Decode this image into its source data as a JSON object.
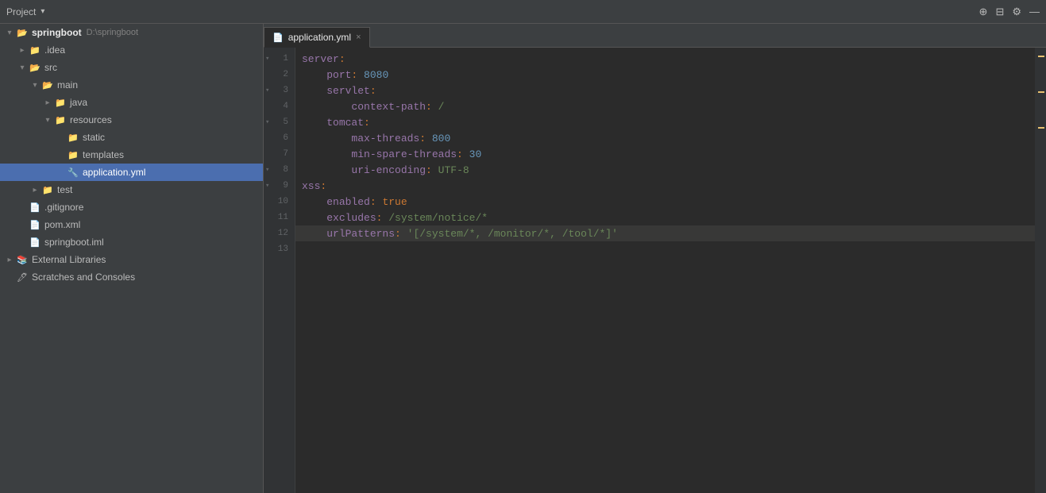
{
  "titleBar": {
    "projectLabel": "Project",
    "icons": {
      "add": "+",
      "layout": "⊟",
      "gear": "⚙",
      "minus": "—"
    }
  },
  "sidebar": {
    "items": [
      {
        "id": "springboot-root",
        "indent": 1,
        "label": "springboot",
        "path": "D:\\springboot",
        "arrow": "open",
        "icon": "folder-open",
        "bold": true
      },
      {
        "id": "idea",
        "indent": 2,
        "label": ".idea",
        "arrow": "closed",
        "icon": "folder"
      },
      {
        "id": "src",
        "indent": 2,
        "label": "src",
        "arrow": "open",
        "icon": "folder-open"
      },
      {
        "id": "main",
        "indent": 3,
        "label": "main",
        "arrow": "open",
        "icon": "folder-open"
      },
      {
        "id": "java",
        "indent": 4,
        "label": "java",
        "arrow": "closed",
        "icon": "folder-java"
      },
      {
        "id": "resources",
        "indent": 4,
        "label": "resources",
        "arrow": "open",
        "icon": "folder-resources"
      },
      {
        "id": "static",
        "indent": 5,
        "label": "static",
        "arrow": "empty",
        "icon": "folder"
      },
      {
        "id": "templates",
        "indent": 5,
        "label": "templates",
        "arrow": "empty",
        "icon": "folder"
      },
      {
        "id": "application-yml",
        "indent": 5,
        "label": "application.yml",
        "arrow": "empty",
        "icon": "yml",
        "selected": true
      },
      {
        "id": "test",
        "indent": 3,
        "label": "test",
        "arrow": "closed",
        "icon": "folder"
      },
      {
        "id": "gitignore",
        "indent": 2,
        "label": ".gitignore",
        "arrow": "empty",
        "icon": "gitignore"
      },
      {
        "id": "pom-xml",
        "indent": 2,
        "label": "pom.xml",
        "arrow": "empty",
        "icon": "xml"
      },
      {
        "id": "springboot-iml",
        "indent": 2,
        "label": "springboot.iml",
        "arrow": "empty",
        "icon": "iml"
      },
      {
        "id": "external-libraries",
        "indent": 1,
        "label": "External Libraries",
        "arrow": "closed",
        "icon": "libraries"
      },
      {
        "id": "scratches",
        "indent": 1,
        "label": "Scratches and Consoles",
        "arrow": "empty",
        "icon": "scratches"
      }
    ]
  },
  "tab": {
    "icon": "📄",
    "label": "application.yml",
    "closeIcon": "×"
  },
  "codeLines": [
    {
      "num": 1,
      "fold": true,
      "tokens": [
        {
          "type": "yaml-key",
          "text": "server"
        },
        {
          "type": "yaml-colon",
          "text": ":"
        }
      ]
    },
    {
      "num": 2,
      "fold": false,
      "tokens": [
        {
          "type": "yaml-text",
          "text": "  "
        },
        {
          "type": "yaml-key",
          "text": "  port"
        },
        {
          "type": "yaml-colon",
          "text": ":"
        },
        {
          "type": "yaml-text",
          "text": " "
        },
        {
          "type": "yaml-value-num",
          "text": "8080"
        }
      ]
    },
    {
      "num": 3,
      "fold": true,
      "tokens": [
        {
          "type": "yaml-text",
          "text": "  "
        },
        {
          "type": "yaml-key",
          "text": "  servlet"
        },
        {
          "type": "yaml-colon",
          "text": ":"
        }
      ]
    },
    {
      "num": 4,
      "fold": false,
      "tokens": [
        {
          "type": "yaml-text",
          "text": "    "
        },
        {
          "type": "yaml-key",
          "text": "    context-path"
        },
        {
          "type": "yaml-colon",
          "text": ":"
        },
        {
          "type": "yaml-text",
          "text": " "
        },
        {
          "type": "yaml-value-str",
          "text": "/"
        }
      ]
    },
    {
      "num": 5,
      "fold": true,
      "tokens": [
        {
          "type": "yaml-text",
          "text": "  "
        },
        {
          "type": "yaml-key",
          "text": "  tomcat"
        },
        {
          "type": "yaml-colon",
          "text": ":"
        }
      ]
    },
    {
      "num": 6,
      "fold": false,
      "tokens": [
        {
          "type": "yaml-text",
          "text": "    "
        },
        {
          "type": "yaml-key",
          "text": "    max-threads"
        },
        {
          "type": "yaml-colon",
          "text": ":"
        },
        {
          "type": "yaml-text",
          "text": " "
        },
        {
          "type": "yaml-value-num",
          "text": "800"
        }
      ]
    },
    {
      "num": 7,
      "fold": false,
      "tokens": [
        {
          "type": "yaml-text",
          "text": "    "
        },
        {
          "type": "yaml-key",
          "text": "    min-spare-threads"
        },
        {
          "type": "yaml-colon",
          "text": ":"
        },
        {
          "type": "yaml-text",
          "text": " "
        },
        {
          "type": "yaml-value-num",
          "text": "30"
        }
      ]
    },
    {
      "num": 8,
      "fold": true,
      "tokens": [
        {
          "type": "yaml-text",
          "text": "    "
        },
        {
          "type": "yaml-key",
          "text": "    uri-encoding"
        },
        {
          "type": "yaml-colon",
          "text": ":"
        },
        {
          "type": "yaml-text",
          "text": " "
        },
        {
          "type": "yaml-value-str",
          "text": "UTF-8"
        }
      ]
    },
    {
      "num": 9,
      "fold": true,
      "tokens": [
        {
          "type": "yaml-key",
          "text": "xss"
        },
        {
          "type": "yaml-colon",
          "text": ":"
        }
      ]
    },
    {
      "num": 10,
      "fold": false,
      "tokens": [
        {
          "type": "yaml-text",
          "text": "  "
        },
        {
          "type": "yaml-key",
          "text": "  enabled"
        },
        {
          "type": "yaml-colon",
          "text": ":"
        },
        {
          "type": "yaml-text",
          "text": " "
        },
        {
          "type": "yaml-value-bool",
          "text": "true"
        }
      ]
    },
    {
      "num": 11,
      "fold": false,
      "tokens": [
        {
          "type": "yaml-text",
          "text": "  "
        },
        {
          "type": "yaml-key",
          "text": "  excludes"
        },
        {
          "type": "yaml-colon",
          "text": ":"
        },
        {
          "type": "yaml-text",
          "text": " "
        },
        {
          "type": "yaml-value-str",
          "text": "/system/notice/*"
        }
      ]
    },
    {
      "num": 12,
      "fold": false,
      "highlight": true,
      "tokens": [
        {
          "type": "yaml-text",
          "text": "  "
        },
        {
          "type": "yaml-key",
          "text": "  urlPatterns"
        },
        {
          "type": "yaml-colon",
          "text": ":"
        },
        {
          "type": "yaml-text",
          "text": " "
        },
        {
          "type": "yaml-value-str",
          "text": "'[/system/*, /monitor/*, /tool/*]'"
        }
      ]
    },
    {
      "num": 13,
      "fold": false,
      "tokens": []
    }
  ],
  "colors": {
    "accent": "#4b6eaf",
    "background": "#2b2b2b",
    "sidebar": "#3c3f41",
    "lineNumbers": "#313335",
    "selectedItem": "#4b6eaf"
  }
}
